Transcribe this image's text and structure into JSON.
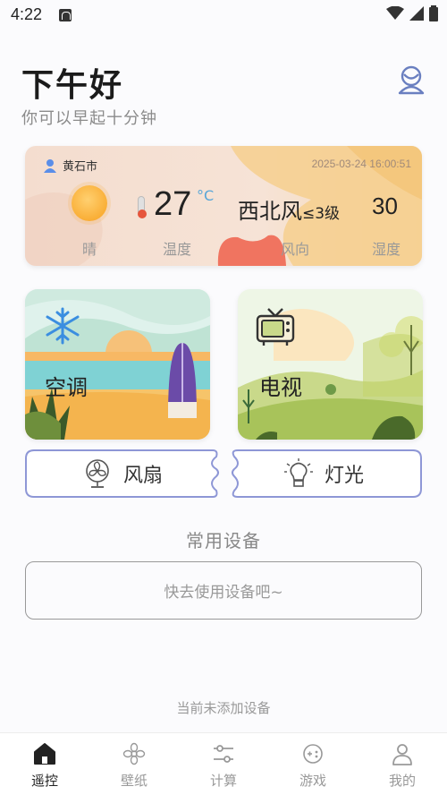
{
  "status_bar": {
    "time": "4:22"
  },
  "header": {
    "greeting": "下午好",
    "subtitle": "你可以早起十分钟"
  },
  "weather": {
    "city": "黄石市",
    "datetime": "2025-03-24 16:00:51",
    "temperature": "27",
    "temperature_unit": "°C",
    "wind_direction": "西北风",
    "wind_level": "≤3级",
    "humidity": "30",
    "labels": {
      "condition": "晴",
      "temperature": "温度",
      "wind": "风向",
      "humidity": "湿度"
    },
    "colors": {
      "sun": "#f7a01e",
      "accent_blob": "#f07460"
    }
  },
  "devices": [
    {
      "label": "空调",
      "icon": "snowflake-icon"
    },
    {
      "label": "电视",
      "icon": "tv-icon"
    },
    {
      "label": "风扇",
      "icon": "fan-icon"
    },
    {
      "label": "灯光",
      "icon": "light-bulb-icon"
    }
  ],
  "common_devices": {
    "title": "常用设备",
    "placeholder": "快去使用设备吧~",
    "empty_note": "当前未添加设备"
  },
  "bottom_nav": {
    "items": [
      {
        "label": "遥控",
        "icon": "home-icon",
        "active": true
      },
      {
        "label": "壁纸",
        "icon": "flower-icon",
        "active": false
      },
      {
        "label": "计算",
        "icon": "sliders-icon",
        "active": false
      },
      {
        "label": "游戏",
        "icon": "gamepad-icon",
        "active": false
      },
      {
        "label": "我的",
        "icon": "user-icon",
        "active": false
      }
    ]
  }
}
